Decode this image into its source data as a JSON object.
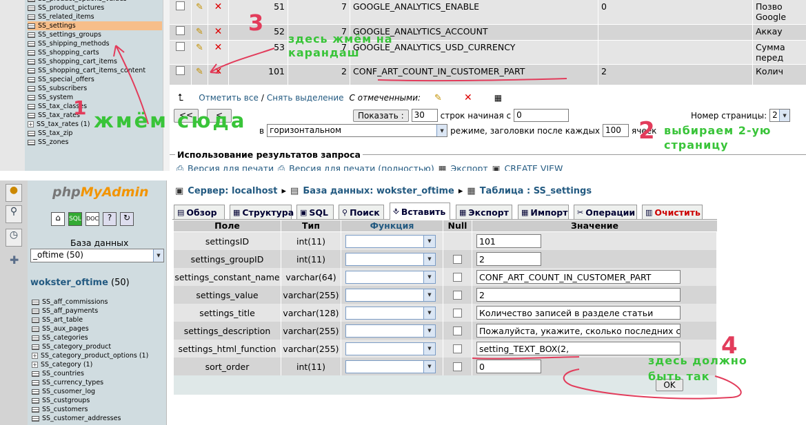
{
  "top": {
    "tables": [
      {
        "label": "SS_product_options_values",
        "expand": false
      },
      {
        "label": "SS_product_pictures",
        "expand": false
      },
      {
        "label": "SS_related_items",
        "expand": false
      },
      {
        "label": "SS_settings",
        "expand": false,
        "highlight": true
      },
      {
        "label": "SS_settings_groups",
        "expand": false
      },
      {
        "label": "SS_shipping_methods",
        "expand": false
      },
      {
        "label": "SS_shopping_carts",
        "expand": false
      },
      {
        "label": "SS_shopping_cart_items",
        "expand": false
      },
      {
        "label": "SS_shopping_cart_items_content",
        "expand": false
      },
      {
        "label": "SS_special_offers",
        "expand": false
      },
      {
        "label": "SS_subscribers",
        "expand": false
      },
      {
        "label": "SS_system",
        "expand": false
      },
      {
        "label": "SS_tax_classes",
        "expand": false
      },
      {
        "label": "SS_tax_rates",
        "expand": false
      },
      {
        "label": "SS_tax_rates (1)",
        "expand": true
      },
      {
        "label": "SS_tax_zip",
        "expand": false
      },
      {
        "label": "SS_zones",
        "expand": false
      }
    ],
    "rows": [
      {
        "id": "51",
        "group": "7",
        "constant": "GOOGLE_ANALYTICS_ENABLE",
        "value": "0",
        "title": "Позво",
        "title2": "Google"
      },
      {
        "id": "52",
        "group": "7",
        "constant": "GOOGLE_ANALYTICS_ACCOUNT",
        "value": "",
        "title": "Аккау",
        "title2": ""
      },
      {
        "id": "53",
        "group": "7",
        "constant": "GOOGLE_ANALYTICS_USD_CURRENCY",
        "value": "",
        "title": "Сумма",
        "title2": "перед"
      },
      {
        "id": "101",
        "group": "2",
        "constant": "CONF_ART_COUNT_IN_CUSTOMER_PART",
        "value": "2",
        "title": "Колич",
        "title2": ""
      }
    ],
    "mark_all": "Отметить все",
    "separator": " / ",
    "unmark_all": "Снять выделение",
    "with_selected": "С отмеченными:",
    "nav_prev": "<<",
    "nav_prev2": "<",
    "show_button": "Показать :",
    "rows_value": "30",
    "start_label": "строк начиная с",
    "start_value": "0",
    "page_label": "Номер страницы:",
    "page_value": "2",
    "in_label": "в",
    "mode_value": "горизонтальном",
    "mode_label": "режиме, заголовки после каждых",
    "headers_every": "100",
    "cells_label": "ячеек",
    "query_usage": "Использование результатов запроса",
    "link_print": "Версия для печати",
    "link_print_full": "Версия для печати (полностью)",
    "link_export": "Экспорт",
    "link_create_view": "CREATE VIEW"
  },
  "annotations": {
    "n1": "1",
    "t1": "жмём сюда",
    "n2": "2",
    "t2a": "выбираем 2-ую",
    "t2b": "страницу",
    "n3": "3",
    "t3a": "здесь жмём на",
    "t3b": "карандаш",
    "n4": "4",
    "t4a": "здесь должно",
    "t4b": "быть так"
  },
  "bottom": {
    "logo_php": "php",
    "logo_my": "MyAdmin",
    "db_label": "База данных",
    "db_select": "_oftime (50)",
    "db_name": "wokster_oftime",
    "db_count": "(50)",
    "tables": [
      {
        "label": "SS_aff_commissions",
        "expand": false
      },
      {
        "label": "SS_aff_payments",
        "expand": false
      },
      {
        "label": "SS_art_table",
        "expand": false
      },
      {
        "label": "SS_aux_pages",
        "expand": false
      },
      {
        "label": "SS_categories",
        "expand": false
      },
      {
        "label": "SS_category_product",
        "expand": false
      },
      {
        "label": "SS_category_product_options (1)",
        "expand": true
      },
      {
        "label": "SS_category (1)",
        "expand": true
      },
      {
        "label": "SS_countries",
        "expand": false
      },
      {
        "label": "SS_currency_types",
        "expand": false
      },
      {
        "label": "SS_cusomer_log",
        "expand": false
      },
      {
        "label": "SS_custgroups",
        "expand": false
      },
      {
        "label": "SS_customers",
        "expand": false
      },
      {
        "label": "SS_customer_addresses",
        "expand": false
      }
    ],
    "crumb_server": "Сервер: localhost",
    "crumb_db": "База данных: wokster_oftime",
    "crumb_table": "Таблица : SS_settings",
    "tabs": [
      "Обзор",
      "Структура",
      "SQL",
      "Поиск",
      "Вставить",
      "Экспорт",
      "Импорт",
      "Операции",
      "Очистить"
    ],
    "headers": {
      "field": "Поле",
      "type": "Тип",
      "function": "Функция",
      "null": "Null",
      "value": "Значение"
    },
    "fields": [
      {
        "name": "settingsID",
        "type": "int(11)",
        "value": "101",
        "null": false
      },
      {
        "name": "settings_groupID",
        "type": "int(11)",
        "value": "2",
        "null": true
      },
      {
        "name": "settings_constant_name",
        "type": "varchar(64)",
        "value": "CONF_ART_COUNT_IN_CUSTOMER_PART",
        "null": true
      },
      {
        "name": "settings_value",
        "type": "varchar(255)",
        "value": "2",
        "null": true
      },
      {
        "name": "settings_title",
        "type": "varchar(128)",
        "value": "Количество записей в разделе статьи",
        "null": true
      },
      {
        "name": "settings_description",
        "type": "varchar(255)",
        "value": "Пожалуйста, укажите, сколько последних статей",
        "null": true
      },
      {
        "name": "settings_html_function",
        "type": "varchar(255)",
        "value": "setting_TEXT_BOX(2,",
        "null": true
      },
      {
        "name": "sort_order",
        "type": "int(11)",
        "value": "0",
        "null": true
      }
    ],
    "ok": "OK"
  }
}
